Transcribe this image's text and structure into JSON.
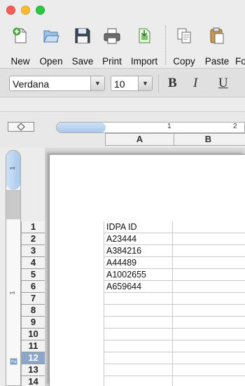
{
  "window": {
    "traffic_lights": {
      "close_color": "#fc5f57",
      "minimize_color": "#fdbc2e",
      "zoom_color": "#28c840"
    }
  },
  "toolbar": {
    "buttons": [
      {
        "label": "New",
        "icon": "new-document-icon"
      },
      {
        "label": "Open",
        "icon": "open-folder-icon"
      },
      {
        "label": "Save",
        "icon": "save-disk-icon"
      },
      {
        "label": "Print",
        "icon": "printer-icon"
      },
      {
        "label": "Import",
        "icon": "import-icon"
      },
      {
        "label": "Copy",
        "icon": "copy-icon"
      },
      {
        "label": "Paste",
        "icon": "paste-icon"
      },
      {
        "label": "Fo"
      }
    ]
  },
  "formatbar": {
    "font_name": "Verdana",
    "font_size": "10",
    "bold_label": "B",
    "italic_label": "I",
    "underline_label": "U"
  },
  "ruler": {
    "marks": [
      "1",
      "2"
    ]
  },
  "sheet": {
    "columns": [
      "A",
      "B"
    ],
    "rows": [
      "1",
      "2",
      "3",
      "4",
      "5",
      "6",
      "7",
      "8",
      "9",
      "10",
      "11",
      "12",
      "13",
      "14"
    ],
    "selected_row": "12",
    "cells_A": [
      "IDPA ID",
      "A23444",
      "A384216",
      "A44489",
      "A1002655",
      "A659644",
      "",
      "",
      "",
      "",
      "",
      "",
      "",
      ""
    ],
    "vertical_ruler_marks": [
      "1",
      "1",
      "2"
    ]
  }
}
